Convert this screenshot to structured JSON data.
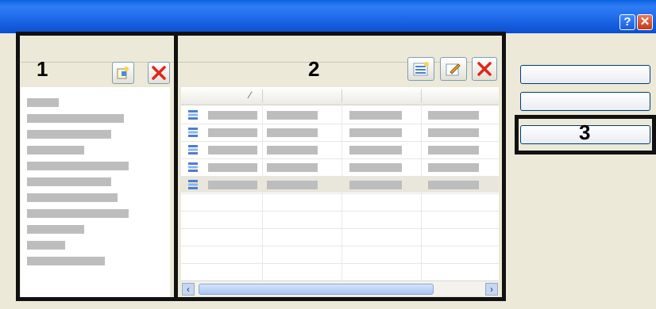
{
  "window": {
    "title": "",
    "help_glyph": "?",
    "close_glyph": "✕"
  },
  "panel1": {
    "label": "1",
    "toolbar": [
      "new-item-icon",
      "delete-icon"
    ],
    "list_items": [
      "",
      "",
      "",
      "",
      "",
      "",
      "",
      "",
      "",
      "",
      ""
    ]
  },
  "panel2": {
    "label": "2",
    "toolbar": [
      "new-row-icon",
      "edit-icon",
      "delete-icon"
    ],
    "sort_indicator": "⁄",
    "rows": [
      {
        "icon": "row-icon",
        "selected": false
      },
      {
        "icon": "row-icon",
        "selected": false
      },
      {
        "icon": "row-icon",
        "selected": false
      },
      {
        "icon": "row-icon",
        "selected": false
      },
      {
        "icon": "row-icon",
        "selected": true
      }
    ],
    "scroll_left": "‹",
    "scroll_right": "›"
  },
  "panel3": {
    "label": "3",
    "buttons": [
      "",
      "",
      ""
    ]
  },
  "colors": {
    "title_bar": "#1c66e6",
    "highlight_border": "#111111",
    "placeholder_bar": "#bdbdbd",
    "delete_red": "#e0261a",
    "selected_row": "#e9e7dc"
  }
}
